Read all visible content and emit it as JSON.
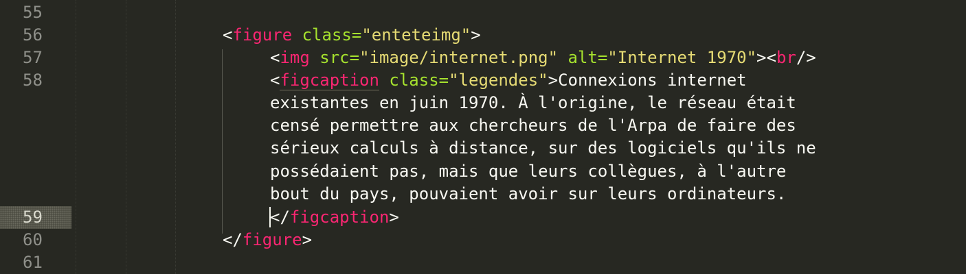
{
  "gutter": {
    "line_numbers": [
      "55",
      "56",
      "57",
      "58",
      "59",
      "60",
      "61"
    ],
    "active_line": "59"
  },
  "code": {
    "l56": {
      "open": "<",
      "tag": "figure",
      "attr": " class=",
      "value": "\"enteteimg\"",
      "close": ">"
    },
    "l57": {
      "open": "<",
      "tag": "img",
      "attr1": " src=",
      "value1": "\"image/internet.png\"",
      "attr2": " alt=",
      "value2": "\"Internet 1970\"",
      "mid": "><",
      "tag2": "br",
      "close": "/>"
    },
    "l58": {
      "open": "<",
      "tag": "figcaption",
      "attr": " class=",
      "value": "\"legendes\"",
      "close": ">",
      "text": [
        "Connexions internet",
        "existantes en juin 1970. À l'origine, le réseau était",
        "censé permettre aux chercheurs de l'Arpa de faire des",
        "sérieux calculs à distance, sur des logiciels qu'ils ne",
        "possédaient pas, mais que leurs collègues, à l'autre",
        "bout du pays, pouvaient avoir sur leurs ordinateurs."
      ]
    },
    "l59": {
      "open": "</",
      "tag": "figcaption",
      "close": ">"
    },
    "l60": {
      "open": "</",
      "tag": "figure",
      "close": ">"
    }
  },
  "theme": {
    "background": "#272822",
    "foreground": "#F8F8F2",
    "tag_color": "#F92672",
    "attribute_color": "#A6E22E",
    "string_color": "#E6DB74",
    "gutter_text": "#8F908A"
  }
}
